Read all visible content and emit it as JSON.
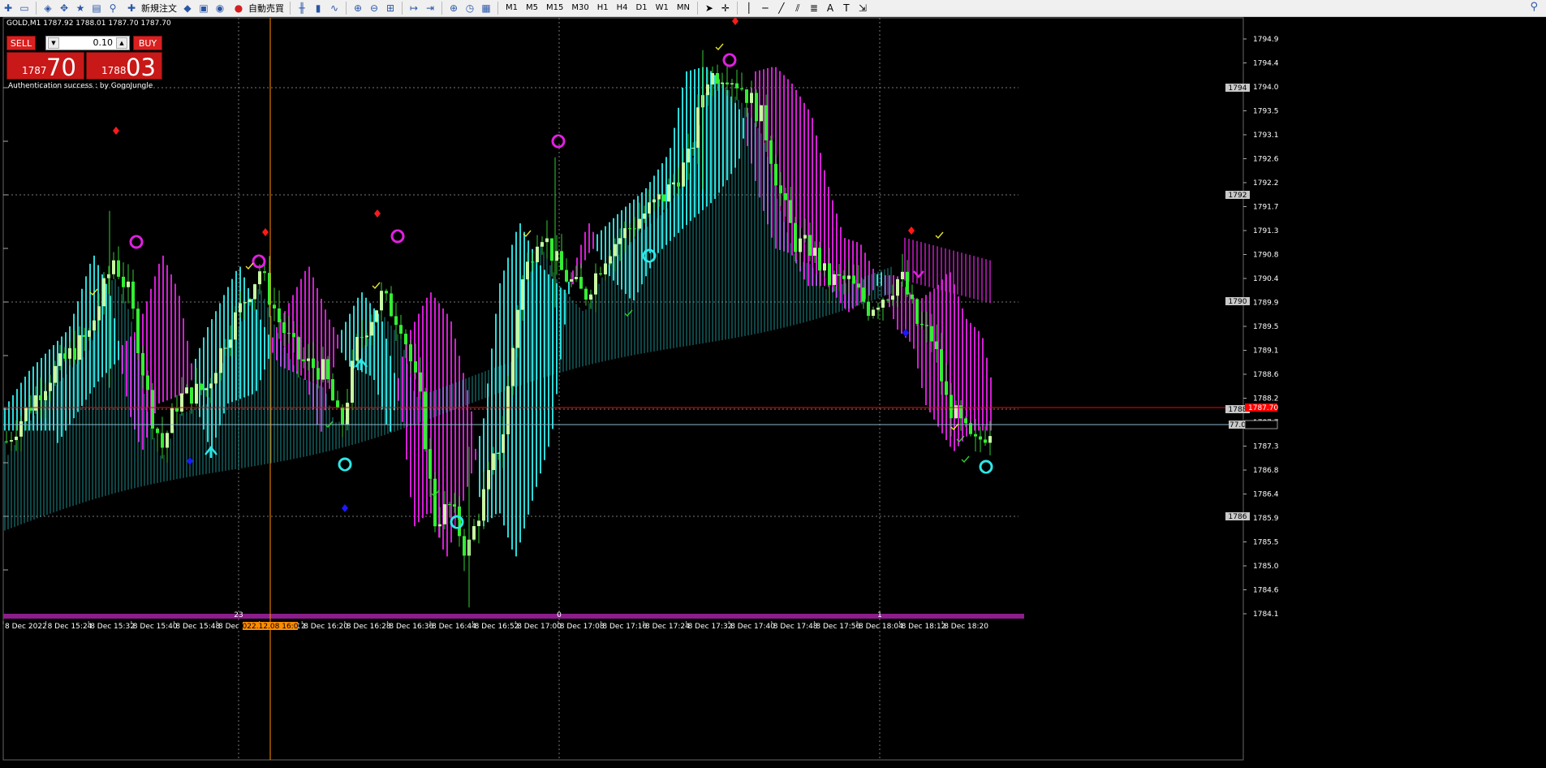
{
  "toolbar": {
    "new_order_label": "新規注文",
    "auto_trading_label": "自動売買",
    "timeframes": [
      "M1",
      "M5",
      "M15",
      "M30",
      "H1",
      "H4",
      "D1",
      "W1",
      "MN"
    ]
  },
  "symbol_header": "GOLD,M1  1787.92 1788.01 1787.70 1787.70",
  "trade_panel": {
    "sell_label": "SELL",
    "buy_label": "BUY",
    "lot_value": "0.10",
    "bid_small": "1787",
    "bid_large": "70",
    "ask_small": "1788",
    "ask_large": "03"
  },
  "auth_text": "Authentication success : by GogoJungle",
  "price_axis": {
    "labels": [
      "1794.9",
      "1794.4",
      "1794.0",
      "1793.5",
      "1793.1",
      "1792.6",
      "1792.2",
      "1791.7",
      "1791.3",
      "1790.8",
      "1790.4",
      "1789.9",
      "1789.5",
      "1789.1",
      "1788.6",
      "1788.2",
      "1787.7",
      "1787.3",
      "1786.8",
      "1786.4",
      "1785.9",
      "1785.5",
      "1785.0",
      "1784.6",
      "1784.1"
    ],
    "round_tags": [
      "1794",
      "1792",
      "1790",
      "1788",
      "1786"
    ],
    "current_tag": "1787.70",
    "line_tag": "77.0"
  },
  "time_axis": {
    "labels": [
      "8 Dec 2022",
      "8 Dec 15:24",
      "8 Dec 15:32",
      "8 Dec 15:40",
      "8 Dec 15:48",
      "8 Dec 15:",
      "8 Dec 16:12",
      "8 Dec 16:20",
      "8 Dec 16:28",
      "8 Dec 16:36",
      "8 Dec 16:44",
      "8 Dec 16:52",
      "8 Dec 17:00",
      "8 Dec 17:08",
      "8 Dec 17:16",
      "8 Dec 17:24",
      "8 Dec 17:32",
      "8 Dec 17:40",
      "8 Dec 17:48",
      "8 Dec 17:56",
      "8 Dec 18:04",
      "8 Dec 18:12",
      "8 Dec 18:20"
    ],
    "crosshair_time": "2022.12.08 16:06"
  },
  "period_separator_labels": [
    "23",
    "0",
    "1"
  ],
  "colors": {
    "background": "#000000",
    "bull_candle": "#c8f7a2",
    "bear_candle": "#33ee33",
    "cloud_up": "#2ee6e6",
    "cloud_down": "#e020e0",
    "bid_line": "#ff0000",
    "ask_line": "#8cb8cc",
    "crosshair": "#ff8c00",
    "panel_red": "#d92020"
  }
}
